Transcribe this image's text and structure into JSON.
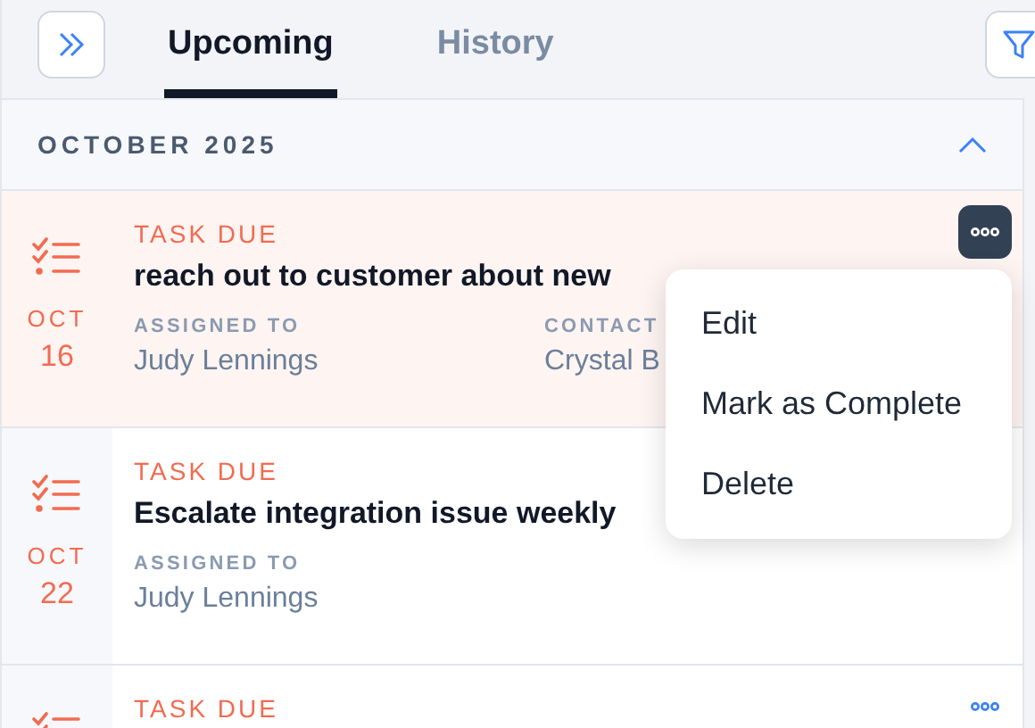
{
  "tabs": [
    {
      "label": "Upcoming",
      "selected": true
    },
    {
      "label": "History",
      "selected": false
    }
  ],
  "section": {
    "title": "OCTOBER 2025",
    "expanded": true
  },
  "tasks": [
    {
      "type": "TASK DUE",
      "title": "reach out to customer about new",
      "month": "OCT",
      "day": "16",
      "highlighted": true,
      "menu_open": true,
      "fields": [
        {
          "label": "ASSIGNED TO",
          "value": "Judy Lennings"
        },
        {
          "label": "CONTACT",
          "value": "Crystal B"
        }
      ]
    },
    {
      "type": "TASK DUE",
      "title": "Escalate integration issue weekly",
      "month": "OCT",
      "day": "22",
      "highlighted": false,
      "fields": [
        {
          "label": "ASSIGNED TO",
          "value": "Judy Lennings"
        }
      ]
    },
    {
      "type": "TASK DUE",
      "highlighted": false,
      "menu_open": false
    }
  ],
  "menu": [
    "Edit",
    "Mark as Complete",
    "Delete"
  ]
}
